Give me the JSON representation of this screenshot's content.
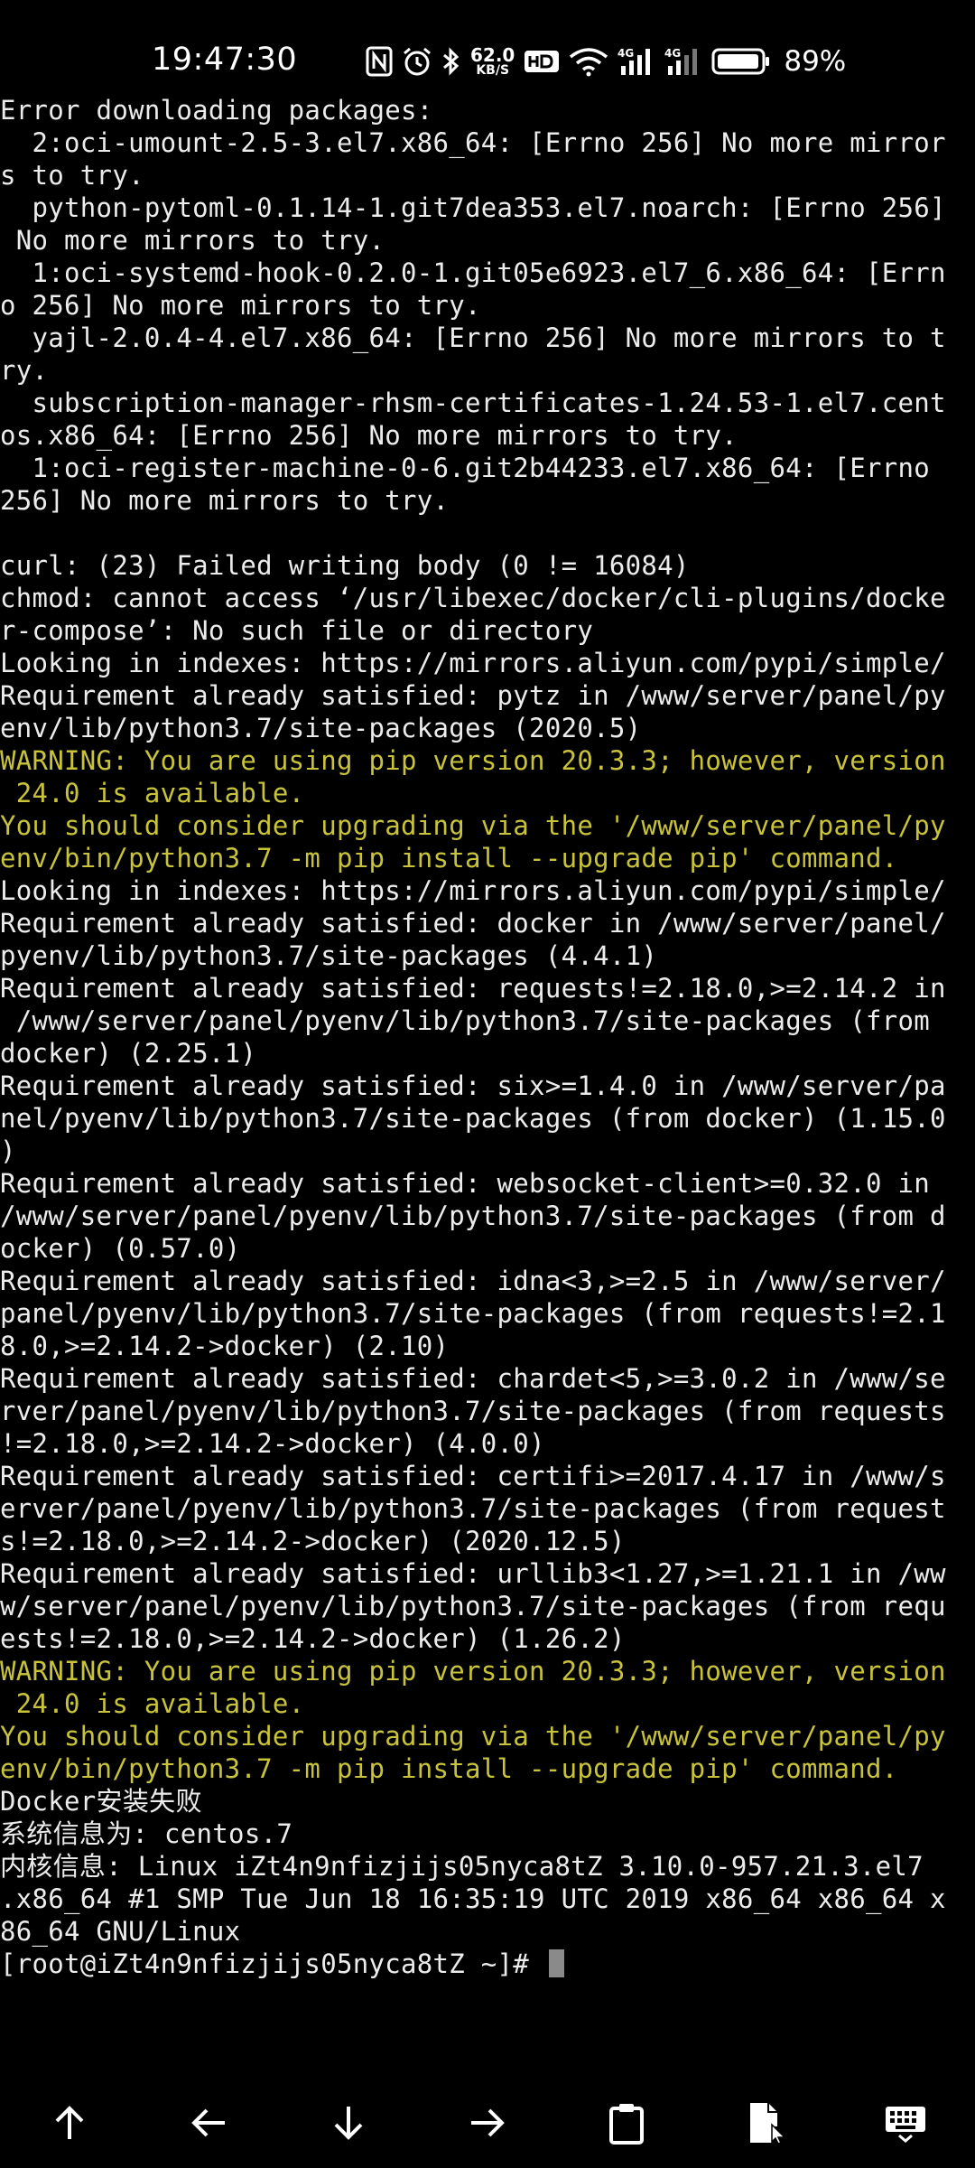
{
  "status_bar": {
    "time": "19:47:30",
    "network_speed_value": "62.0",
    "network_speed_unit": "KB/S",
    "battery_percent": "89%",
    "icons": [
      "nfc-icon",
      "alarm-icon",
      "bluetooth-icon",
      "network-speed",
      "hd-icon",
      "wifi-icon",
      "signal-4g-icon",
      "signal-4g-icon",
      "battery-icon"
    ]
  },
  "terminal": {
    "colors": {
      "text": "#ececec",
      "warning": "#c9c33a",
      "background": "#000000"
    },
    "prompt": "[root@iZt4n9nfizjijs05nyca8tZ ~]# ",
    "lines": [
      {
        "text": "Error downloading packages:",
        "type": "normal"
      },
      {
        "text": "  2:oci-umount-2.5-3.el7.x86_64: [Errno 256] No more mirror",
        "type": "normal"
      },
      {
        "text": "s to try.",
        "type": "normal"
      },
      {
        "text": "  python-pytoml-0.1.14-1.git7dea353.el7.noarch: [Errno 256]",
        "type": "normal"
      },
      {
        "text": " No more mirrors to try.",
        "type": "normal"
      },
      {
        "text": "  1:oci-systemd-hook-0.2.0-1.git05e6923.el7_6.x86_64: [Errn",
        "type": "normal"
      },
      {
        "text": "o 256] No more mirrors to try.",
        "type": "normal"
      },
      {
        "text": "  yajl-2.0.4-4.el7.x86_64: [Errno 256] No more mirrors to t",
        "type": "normal"
      },
      {
        "text": "ry.",
        "type": "normal"
      },
      {
        "text": "  subscription-manager-rhsm-certificates-1.24.53-1.el7.cent",
        "type": "normal"
      },
      {
        "text": "os.x86_64: [Errno 256] No more mirrors to try.",
        "type": "normal"
      },
      {
        "text": "  1:oci-register-machine-0-6.git2b44233.el7.x86_64: [Errno",
        "type": "normal"
      },
      {
        "text": "256] No more mirrors to try.",
        "type": "normal"
      },
      {
        "text": "",
        "type": "normal"
      },
      {
        "text": "curl: (23) Failed writing body (0 != 16084)",
        "type": "normal"
      },
      {
        "text": "chmod: cannot access ‘/usr/libexec/docker/cli-plugins/docke",
        "type": "normal"
      },
      {
        "text": "r-compose’: No such file or directory",
        "type": "normal"
      },
      {
        "text": "Looking in indexes: https://mirrors.aliyun.com/pypi/simple/",
        "type": "normal"
      },
      {
        "text": "Requirement already satisfied: pytz in /www/server/panel/py",
        "type": "normal"
      },
      {
        "text": "env/lib/python3.7/site-packages (2020.5)",
        "type": "normal"
      },
      {
        "text": "WARNING: You are using pip version 20.3.3; however, version",
        "type": "warn"
      },
      {
        "text": " 24.0 is available.",
        "type": "warn"
      },
      {
        "text": "You should consider upgrading via the '/www/server/panel/py",
        "type": "warn"
      },
      {
        "text": "env/bin/python3.7 -m pip install --upgrade pip' command.",
        "type": "warn"
      },
      {
        "text": "Looking in indexes: https://mirrors.aliyun.com/pypi/simple/",
        "type": "normal"
      },
      {
        "text": "Requirement already satisfied: docker in /www/server/panel/",
        "type": "normal"
      },
      {
        "text": "pyenv/lib/python3.7/site-packages (4.4.1)",
        "type": "normal"
      },
      {
        "text": "Requirement already satisfied: requests!=2.18.0,>=2.14.2 in",
        "type": "normal"
      },
      {
        "text": " /www/server/panel/pyenv/lib/python3.7/site-packages (from",
        "type": "normal"
      },
      {
        "text": "docker) (2.25.1)",
        "type": "normal"
      },
      {
        "text": "Requirement already satisfied: six>=1.4.0 in /www/server/pa",
        "type": "normal"
      },
      {
        "text": "nel/pyenv/lib/python3.7/site-packages (from docker) (1.15.0",
        "type": "normal"
      },
      {
        "text": ")",
        "type": "normal"
      },
      {
        "text": "Requirement already satisfied: websocket-client>=0.32.0 in",
        "type": "normal"
      },
      {
        "text": "/www/server/panel/pyenv/lib/python3.7/site-packages (from d",
        "type": "normal"
      },
      {
        "text": "ocker) (0.57.0)",
        "type": "normal"
      },
      {
        "text": "Requirement already satisfied: idna<3,>=2.5 in /www/server/",
        "type": "normal"
      },
      {
        "text": "panel/pyenv/lib/python3.7/site-packages (from requests!=2.1",
        "type": "normal"
      },
      {
        "text": "8.0,>=2.14.2->docker) (2.10)",
        "type": "normal"
      },
      {
        "text": "Requirement already satisfied: chardet<5,>=3.0.2 in /www/se",
        "type": "normal"
      },
      {
        "text": "rver/panel/pyenv/lib/python3.7/site-packages (from requests",
        "type": "normal"
      },
      {
        "text": "!=2.18.0,>=2.14.2->docker) (4.0.0)",
        "type": "normal"
      },
      {
        "text": "Requirement already satisfied: certifi>=2017.4.17 in /www/s",
        "type": "normal"
      },
      {
        "text": "erver/panel/pyenv/lib/python3.7/site-packages (from request",
        "type": "normal"
      },
      {
        "text": "s!=2.18.0,>=2.14.2->docker) (2020.12.5)",
        "type": "normal"
      },
      {
        "text": "Requirement already satisfied: urllib3<1.27,>=1.21.1 in /ww",
        "type": "normal"
      },
      {
        "text": "w/server/panel/pyenv/lib/python3.7/site-packages (from requ",
        "type": "normal"
      },
      {
        "text": "ests!=2.18.0,>=2.14.2->docker) (1.26.2)",
        "type": "normal"
      },
      {
        "text": "WARNING: You are using pip version 20.3.3; however, version",
        "type": "warn"
      },
      {
        "text": " 24.0 is available.",
        "type": "warn"
      },
      {
        "text": "You should consider upgrading via the '/www/server/panel/py",
        "type": "warn"
      },
      {
        "text": "env/bin/python3.7 -m pip install --upgrade pip' command.",
        "type": "warn"
      },
      {
        "text": "Docker安装失败",
        "type": "normal"
      },
      {
        "text": "系统信息为: centos.7",
        "type": "normal"
      },
      {
        "text": "内核信息: Linux iZt4n9nfizjijs05nyca8tZ 3.10.0-957.21.3.el7",
        "type": "normal"
      },
      {
        "text": ".x86_64 #1 SMP Tue Jun 18 16:35:19 UTC 2019 x86_64 x86_64 x",
        "type": "normal"
      },
      {
        "text": "86_64 GNU/Linux",
        "type": "normal"
      }
    ]
  },
  "key_bar": {
    "keys": [
      "arrow-up-icon",
      "arrow-left-icon",
      "arrow-down-icon",
      "arrow-right-icon",
      "clipboard-icon",
      "file-cursor-icon",
      "keyboard-icon"
    ]
  }
}
